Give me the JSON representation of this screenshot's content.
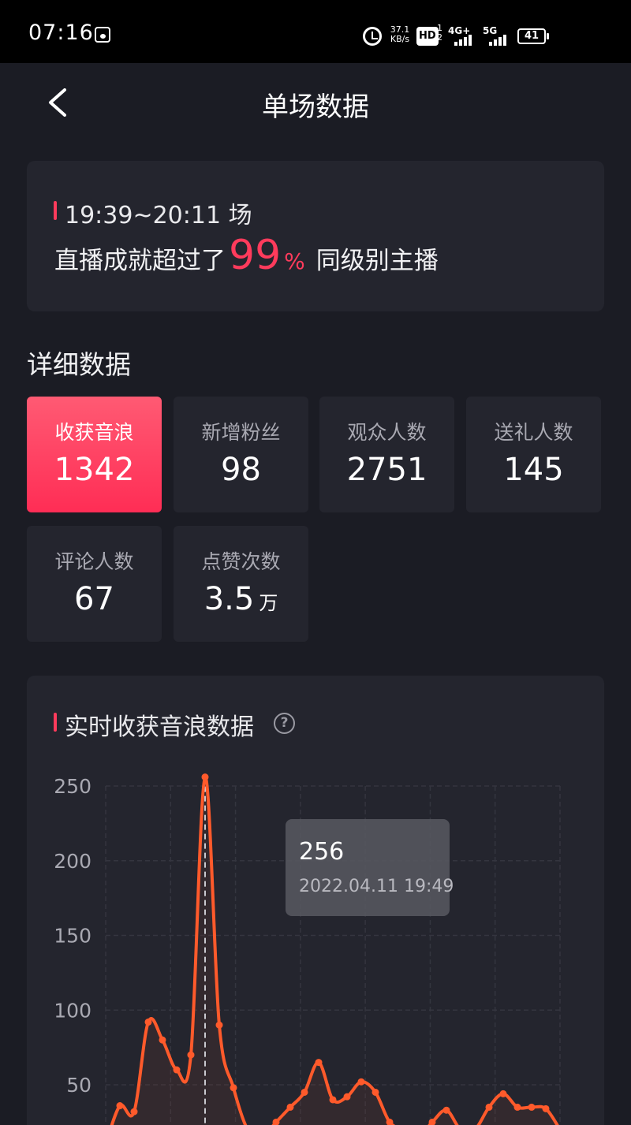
{
  "status_bar": {
    "time": "07:16",
    "speed": "37.1\nKB/s",
    "hd": "HD",
    "hd_sub": "1\n2",
    "sig1": "4G+",
    "sig2": "5G",
    "battery": "41"
  },
  "header": {
    "title": "单场数据"
  },
  "summary": {
    "session": "19:39~20:11 场",
    "prefix": "直播成就超过了",
    "percent": "99",
    "percent_sign": "%",
    "suffix": "同级别主播"
  },
  "details": {
    "title": "详细数据",
    "stats": [
      {
        "label": "收获音浪",
        "value": "1342",
        "unit": ""
      },
      {
        "label": "新增粉丝",
        "value": "98",
        "unit": ""
      },
      {
        "label": "观众人数",
        "value": "2751",
        "unit": ""
      },
      {
        "label": "送礼人数",
        "value": "145",
        "unit": ""
      },
      {
        "label": "评论人数",
        "value": "67",
        "unit": ""
      },
      {
        "label": "点赞次数",
        "value": "3.5",
        "unit": "万"
      }
    ]
  },
  "chart": {
    "title": "实时收获音浪数据",
    "tooltip_value": "256",
    "tooltip_time": "2022.04.11 19:49"
  },
  "chart_data": {
    "type": "line",
    "title": "实时收获音浪数据",
    "ylim": [
      0,
      250
    ],
    "yticks": [
      "250",
      "200",
      "150",
      "100",
      "50"
    ],
    "color": "#ff5a2b",
    "x": [
      0,
      1,
      2,
      3,
      4,
      5,
      6,
      7,
      8,
      9,
      10,
      11,
      12,
      13,
      14,
      15,
      16,
      17,
      18,
      19,
      20,
      21,
      22,
      23,
      24,
      25,
      26,
      27,
      28,
      29,
      30,
      31,
      32
    ],
    "values": [
      10,
      36,
      32,
      92,
      80,
      60,
      70,
      256,
      90,
      48,
      20,
      15,
      25,
      35,
      45,
      65,
      40,
      42,
      52,
      45,
      25,
      20,
      15,
      25,
      33,
      20,
      20,
      35,
      44,
      35,
      35,
      34,
      20
    ]
  }
}
